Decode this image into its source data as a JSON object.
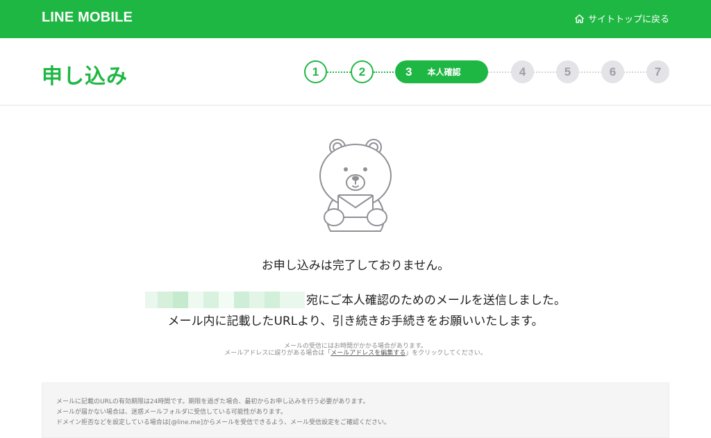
{
  "topbar": {
    "logo": "LINE MOBILE",
    "site_top_link": "サイトトップに戻る",
    "home_icon": "home-icon"
  },
  "header": {
    "title": "申し込み",
    "steps": [
      {
        "number": "1",
        "state": "done"
      },
      {
        "number": "2",
        "state": "done"
      },
      {
        "number": "3",
        "state": "current",
        "label": "本人確認"
      },
      {
        "number": "4",
        "state": "todo"
      },
      {
        "number": "5",
        "state": "todo"
      },
      {
        "number": "6",
        "state": "todo"
      },
      {
        "number": "7",
        "state": "todo"
      }
    ]
  },
  "main": {
    "illustration": "bear-with-envelope",
    "status_message": "お申し込みは完了しておりません。",
    "sent_message": "宛にご本人確認のためのメールを送信しました。",
    "instruction": "メール内に記載したURLより、引き続きお手続きをお願いいたします。",
    "note_line1": "メールの受信にはお時間がかかる場合があります。",
    "note_line2_prefix": "メールアドレスに誤りがある場合は「",
    "note_line2_link": "メールアドレスを編集する",
    "note_line2_suffix": "」をクリックしてください。"
  },
  "info": {
    "lines": [
      "メールに記載のURLの有効期限は24時間です。期限を過ぎた場合、最初からお申し込みを行う必要があります。",
      "メールが届かない場合は、迷惑メールフォルダに受信している可能性があります。",
      "ドメイン拒否などを設定している場合は[@line.me]からメールを受信できるよう、メール受信設定をご確認ください。"
    ]
  },
  "colors": {
    "brand_green": "#1fb743",
    "step_inactive": "#e3e3e8"
  }
}
